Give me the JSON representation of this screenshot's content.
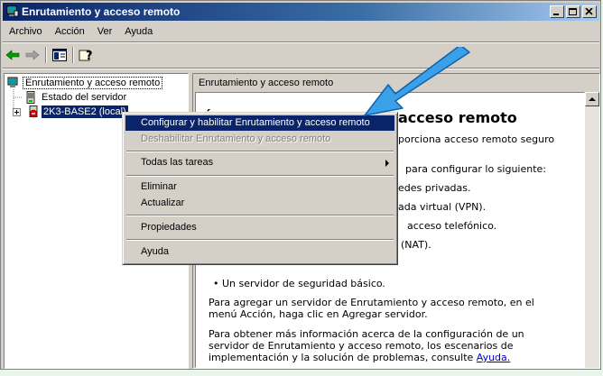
{
  "window": {
    "title": "Enrutamiento y acceso remoto"
  },
  "menubar": {
    "items": [
      "Archivo",
      "Acción",
      "Ver",
      "Ayuda"
    ]
  },
  "toolbar": {
    "buttons": [
      "back-arrow-icon",
      "forward-arrow-icon",
      "show-hide-tree-icon",
      "help-icon"
    ]
  },
  "tree": {
    "root": "Enrutamiento y acceso remoto",
    "items": [
      "Estado del servidor",
      "2K3-BASE2 (local)"
    ]
  },
  "right_pane": {
    "header": "Enrutamiento y acceso remoto",
    "title_fragment": "acceso remoto",
    "title_prefix": "É",
    "lines": [
      "porciona acceso remoto seguro",
      "para configurar lo siguiente:",
      "edes privadas.",
      "ada virtual (VPN).",
      "acceso telefónico.",
      "(NAT)."
    ],
    "bullet_last": "• Un servidor de seguridad básico.",
    "para1_line1": "Para agregar un servidor de Enrutamiento y acceso remoto, en el",
    "para1_line2": "menú Acción, haga clic en Agregar servidor.",
    "para2_line1": "Para obtener más información acerca de la configuración de un",
    "para2_line2": "servidor de Enrutamiento y acceso remoto, los escenarios de",
    "para2_line3_prefix": "implementación y la solución de problemas, consulte ",
    "help_link": "Ayuda."
  },
  "context_menu": {
    "configure": "Configurar y habilitar Enrutamiento y acceso remoto",
    "disable": "Deshabilitar Enrutamiento y acceso remoto",
    "all_tasks": "Todas las tareas",
    "delete": "Eliminar",
    "refresh": "Actualizar",
    "properties": "Propiedades",
    "help": "Ayuda"
  },
  "colors": {
    "selection": "#0a246a",
    "window_face": "#d4d0c8",
    "pointer_arrow": "#3aa0e8"
  }
}
